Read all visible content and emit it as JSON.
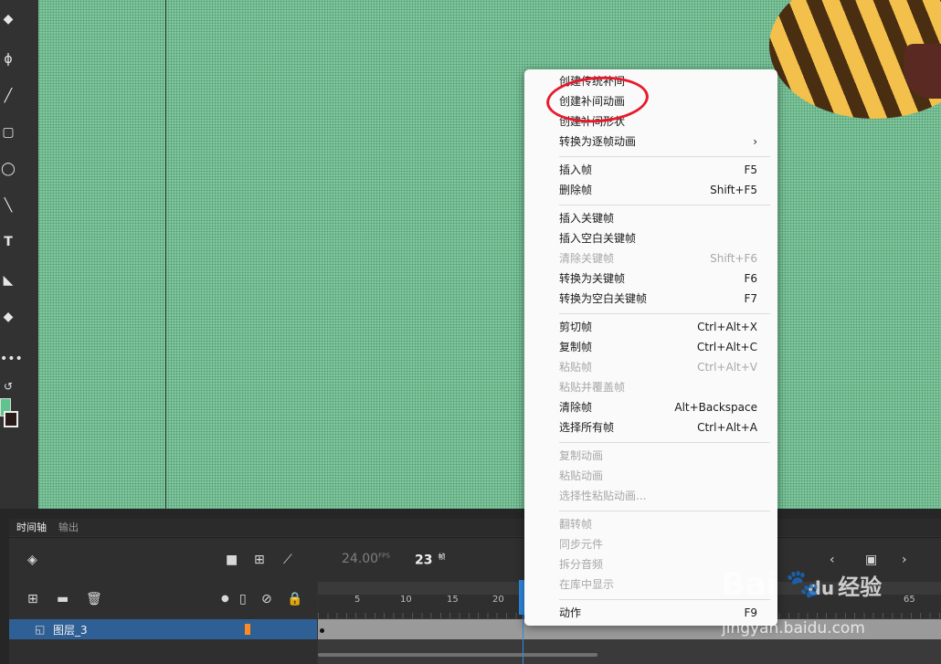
{
  "timeline": {
    "tabs": [
      "时间轴",
      "输出"
    ],
    "fps": "24.00",
    "fps_unit": "FPS",
    "frame": "23",
    "frame_unit": "帧",
    "layer_name": "图层_3",
    "ruler_ticks": [
      "5",
      "10",
      "15",
      "20",
      "65"
    ]
  },
  "context_menu": {
    "groups": [
      [
        {
          "label": "创建传统补间",
          "shortcut": "",
          "disabled": false
        },
        {
          "label": "创建补间动画",
          "shortcut": "",
          "disabled": false
        },
        {
          "label": "创建补间形状",
          "shortcut": "",
          "disabled": false
        },
        {
          "label": "转换为逐帧动画",
          "shortcut": "›",
          "disabled": false
        }
      ],
      [
        {
          "label": "插入帧",
          "shortcut": "F5",
          "disabled": false
        },
        {
          "label": "删除帧",
          "shortcut": "Shift+F5",
          "disabled": false
        }
      ],
      [
        {
          "label": "插入关键帧",
          "shortcut": "",
          "disabled": false
        },
        {
          "label": "插入空白关键帧",
          "shortcut": "",
          "disabled": false
        },
        {
          "label": "清除关键帧",
          "shortcut": "Shift+F6",
          "disabled": true
        },
        {
          "label": "转换为关键帧",
          "shortcut": "F6",
          "disabled": false
        },
        {
          "label": "转换为空白关键帧",
          "shortcut": "F7",
          "disabled": false
        }
      ],
      [
        {
          "label": "剪切帧",
          "shortcut": "Ctrl+Alt+X",
          "disabled": false
        },
        {
          "label": "复制帧",
          "shortcut": "Ctrl+Alt+C",
          "disabled": false
        },
        {
          "label": "粘贴帧",
          "shortcut": "Ctrl+Alt+V",
          "disabled": true
        },
        {
          "label": "粘贴并覆盖帧",
          "shortcut": "",
          "disabled": true
        },
        {
          "label": "清除帧",
          "shortcut": "Alt+Backspace",
          "disabled": false
        },
        {
          "label": "选择所有帧",
          "shortcut": "Ctrl+Alt+A",
          "disabled": false
        }
      ],
      [
        {
          "label": "复制动画",
          "shortcut": "",
          "disabled": true
        },
        {
          "label": "粘贴动画",
          "shortcut": "",
          "disabled": true
        },
        {
          "label": "选择性粘贴动画...",
          "shortcut": "",
          "disabled": true
        }
      ],
      [
        {
          "label": "翻转帧",
          "shortcut": "",
          "disabled": true
        },
        {
          "label": "同步元件",
          "shortcut": "",
          "disabled": true
        },
        {
          "label": "拆分音频",
          "shortcut": "",
          "disabled": true
        },
        {
          "label": "在库中显示",
          "shortcut": "",
          "disabled": true
        }
      ],
      [
        {
          "label": "动作",
          "shortcut": "F9",
          "disabled": false
        }
      ]
    ]
  },
  "watermark": {
    "brand": "Bai",
    "brand2": "du",
    "brand_cn": "经验",
    "url": "jingyan.baidu.com"
  },
  "colors": {
    "stage": "#7cc49b",
    "accent": "#2f8ae0",
    "annotation": "#e8192c",
    "menu_bg": "#fafafa"
  }
}
